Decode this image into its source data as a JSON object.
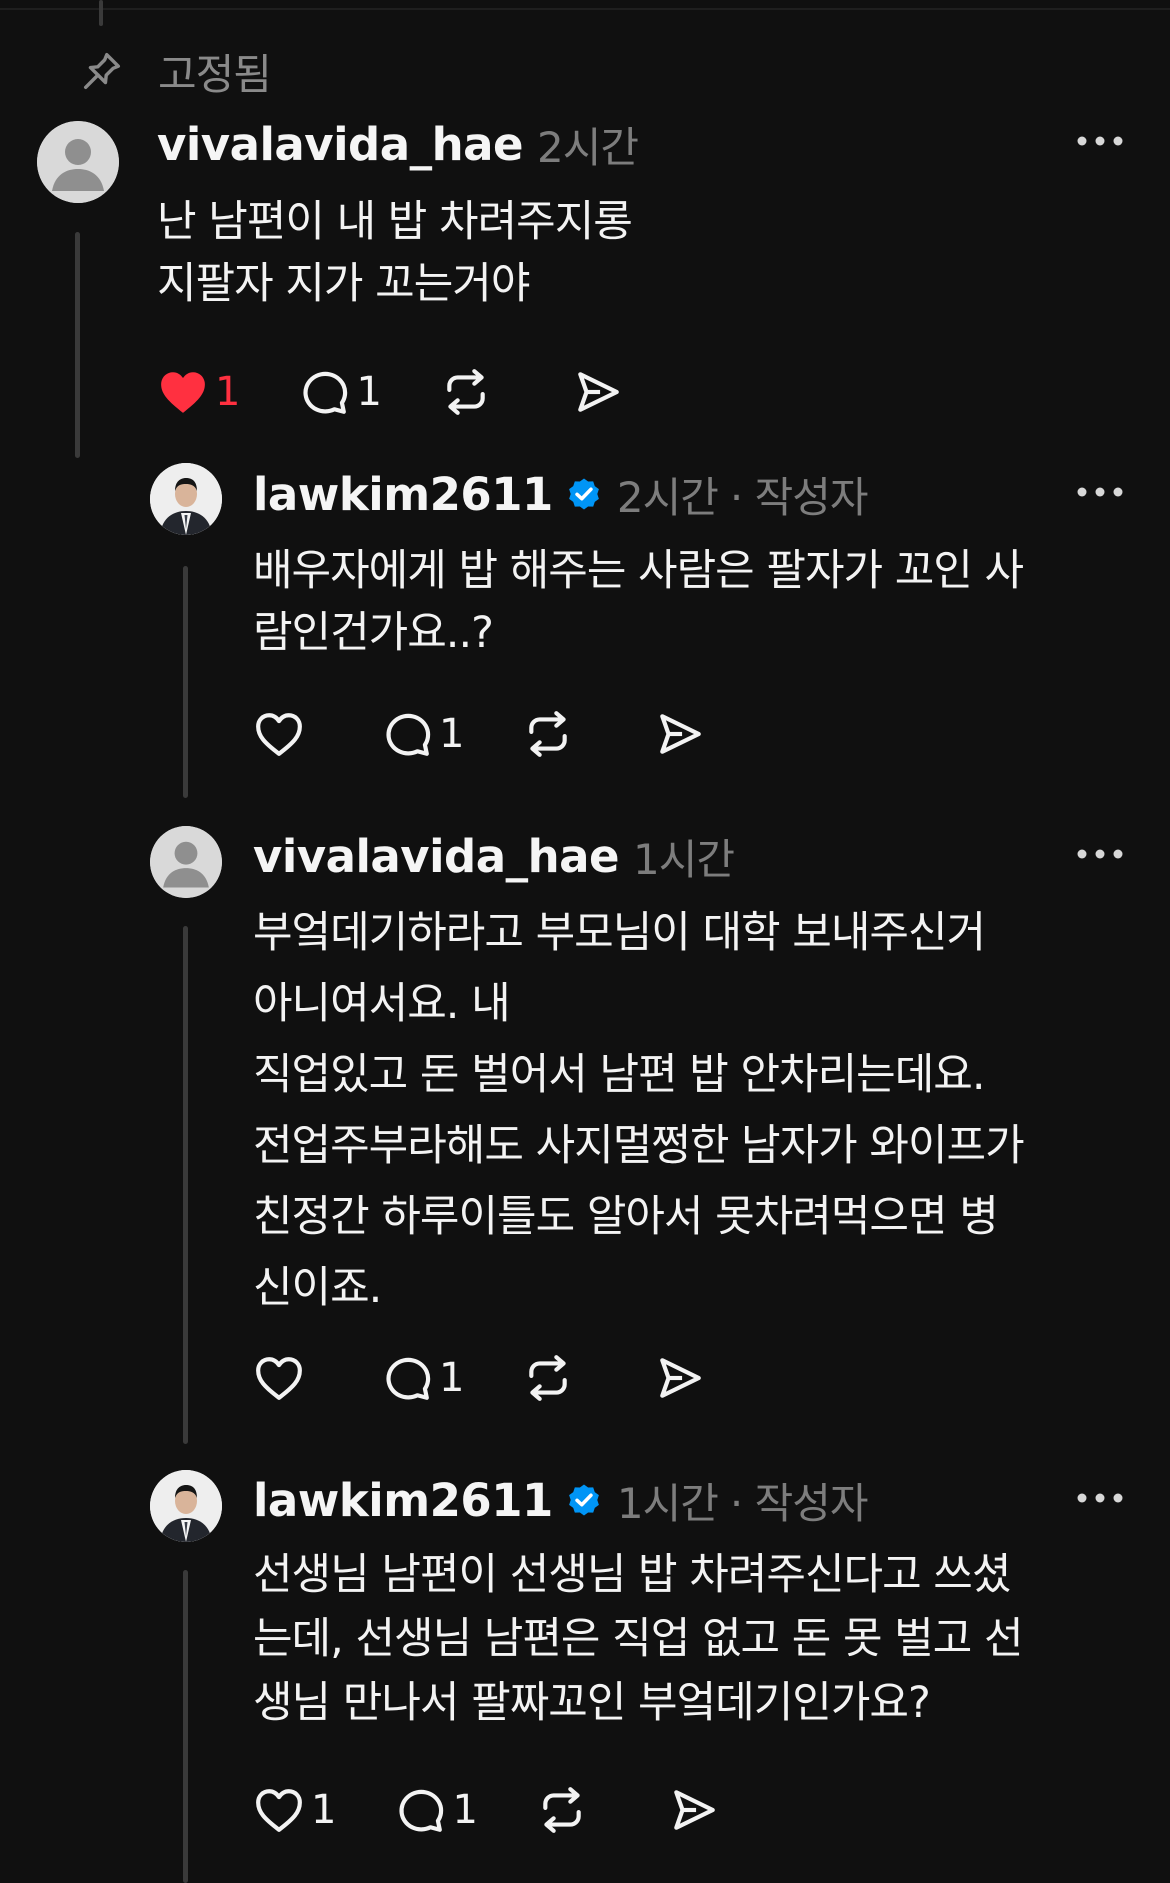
{
  "pinned": {
    "label": "고정됨",
    "icon": "pin-icon"
  },
  "colors": {
    "background": "#101010",
    "text": "#f3f3f3",
    "muted": "#7d7d7d",
    "like_red": "#ff3040",
    "verified_blue": "#0095f6",
    "thread_line": "#3a3a3a"
  },
  "comments": [
    {
      "username": "vivalavida_hae",
      "verified": false,
      "time": "2시간",
      "author_tag": "",
      "lines": [
        "난 남편이 내 밥 차려주지롱",
        "지팔자 지가 꼬는거야"
      ],
      "likes": "1",
      "liked": true,
      "replies": "1",
      "avatar": "default-avatar-icon"
    },
    {
      "username": "lawkim2611",
      "verified": true,
      "time": "2시간",
      "author_tag": "· 작성자",
      "lines": [
        "배우자에게 밥 해주는 사람은 팔자가 꼬인 사",
        "람인건가요..?"
      ],
      "likes": "",
      "liked": false,
      "replies": "1",
      "avatar": "profile-photo"
    },
    {
      "username": "vivalavida_hae",
      "verified": false,
      "time": "1시간",
      "author_tag": "",
      "lines": [
        "부엌데기하라고 부모님이 대학 보내주신거",
        "아니여서요. 내",
        "직업있고 돈 벌어서 남편 밥 안차리는데요.",
        "전업주부라해도 사지멀쩡한 남자가 와이프가",
        "친정간 하루이틀도 알아서 못차려먹으면 병",
        "신이죠."
      ],
      "likes": "",
      "liked": false,
      "replies": "1",
      "avatar": "default-avatar-icon"
    },
    {
      "username": "lawkim2611",
      "verified": true,
      "time": "1시간",
      "author_tag": "· 작성자",
      "lines": [
        "선생님 남편이 선생님 밥 차려주신다고 쓰셨",
        "는데, 선생님 남편은 직업 없고 돈 못 벌고 선",
        "생님 만나서 팔짜꼬인 부엌데기인가요?"
      ],
      "likes": "1",
      "liked": false,
      "replies": "1",
      "avatar": "profile-photo"
    }
  ]
}
